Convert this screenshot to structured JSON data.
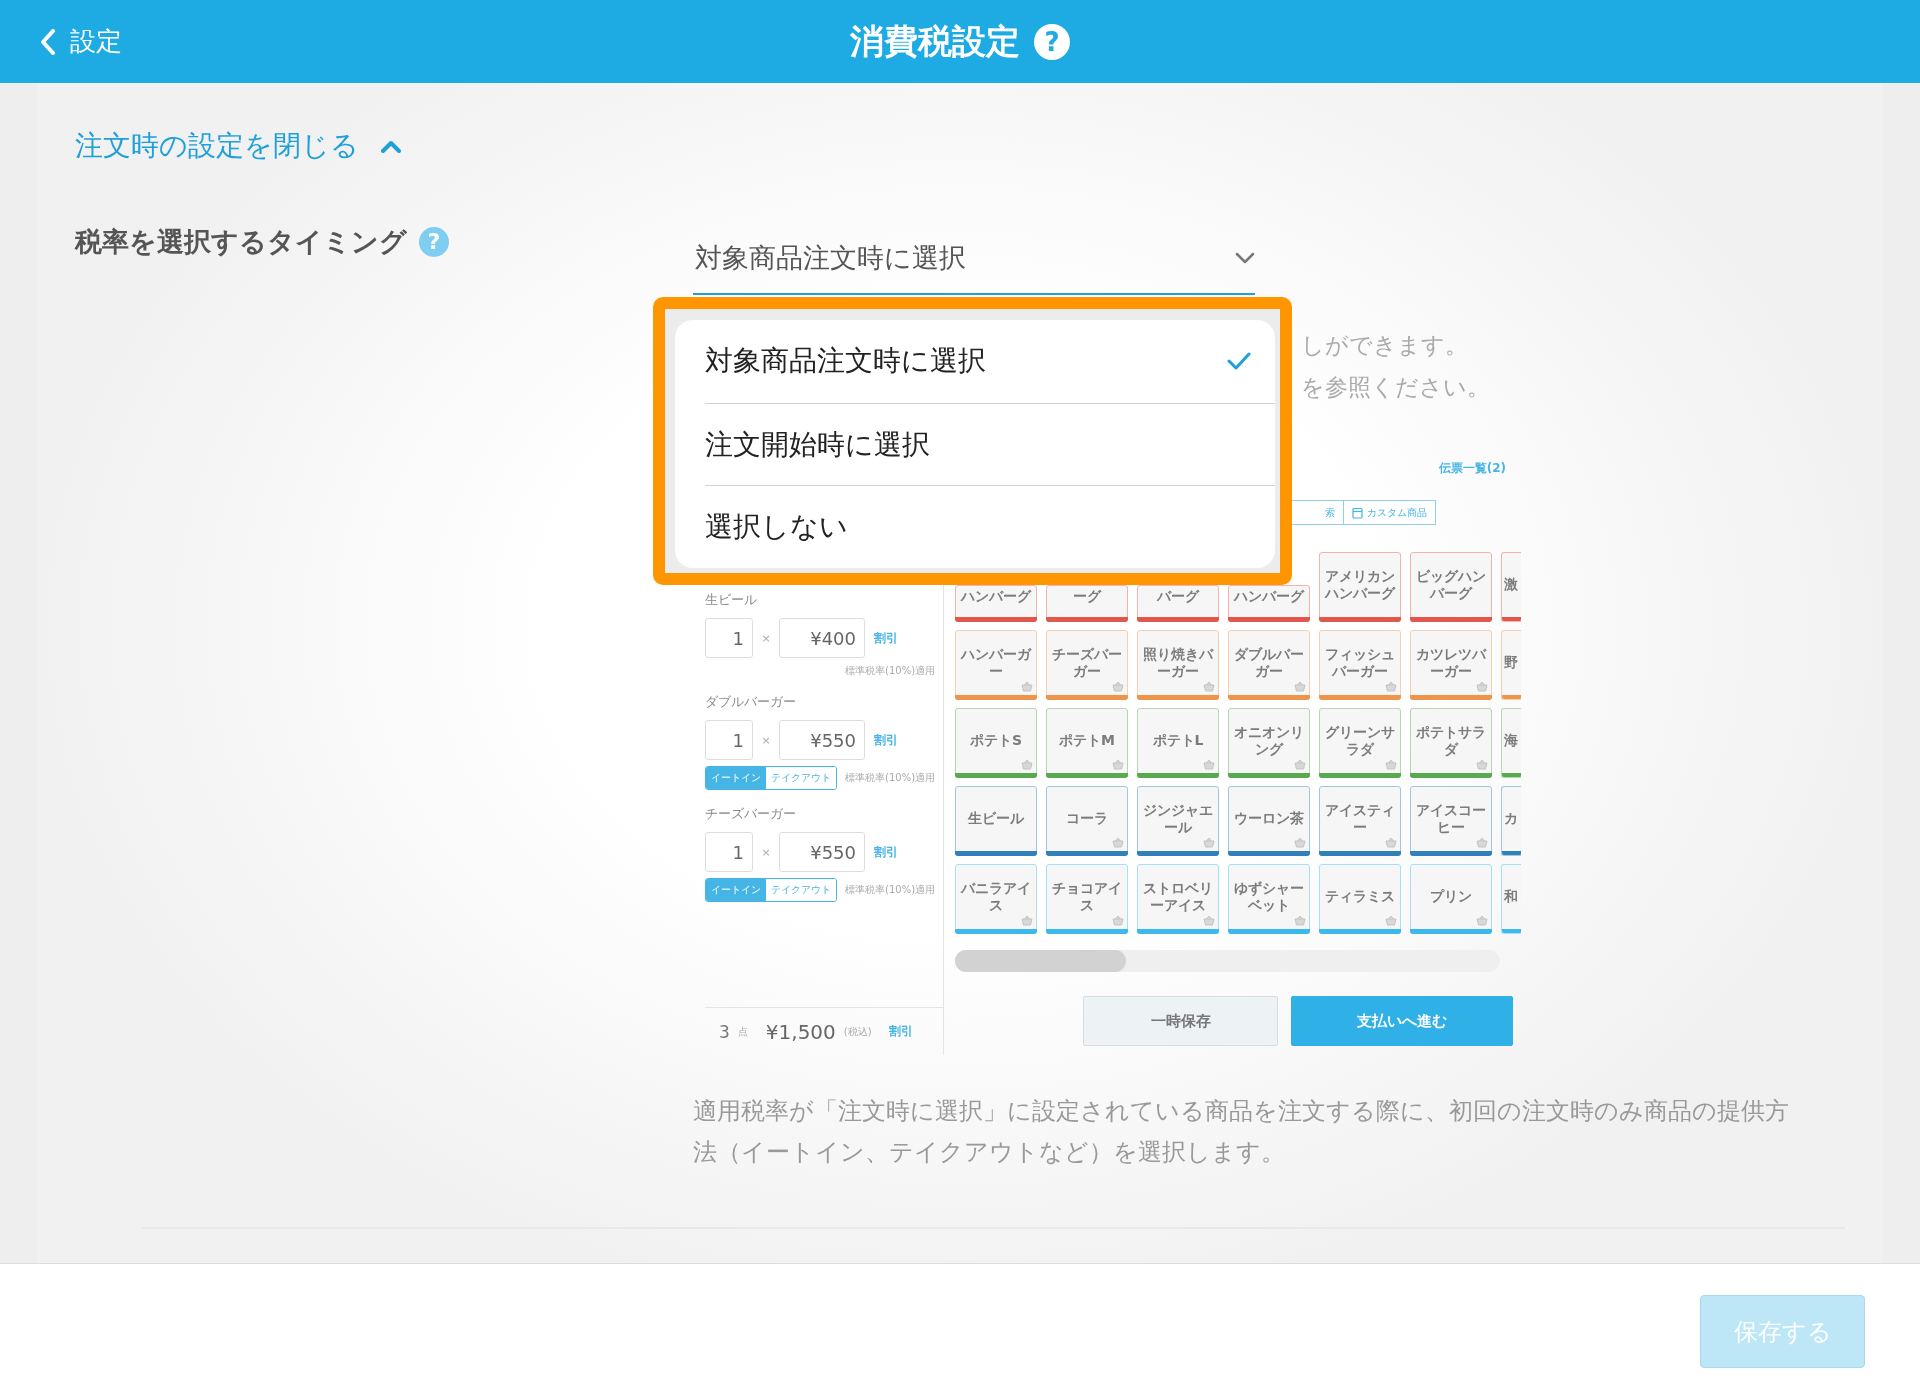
{
  "header": {
    "back_label": "設定",
    "title": "消費税設定",
    "help_icon": "?"
  },
  "collapse_link": "注文時の設定を閉じる",
  "setting": {
    "label": "税率を選択するタイミング",
    "help_icon": "?",
    "select_value": "対象商品注文時に選択"
  },
  "dropdown": {
    "options": [
      {
        "label": "対象商品注文時に選択",
        "selected": true
      },
      {
        "label": "注文開始時に選択",
        "selected": false
      },
      {
        "label": "選択しない",
        "selected": false
      }
    ]
  },
  "hint_lines": [
    "しができます。",
    "を参照ください。"
  ],
  "pos_mock": {
    "slip_list_link": "伝票一覧(2)",
    "tabs": [
      {
        "label": "索",
        "kind": "cut"
      },
      {
        "label": "カスタム商品",
        "kind": "full"
      }
    ],
    "order_items": [
      {
        "name": "生ビール",
        "quantity": "1",
        "multiply": "×",
        "price": "¥400",
        "discount": "割引",
        "note": "標準税率(10%)適用"
      },
      {
        "name": "ダブルバーガー",
        "quantity": "1",
        "multiply": "×",
        "price": "¥550",
        "discount": "割引",
        "note": "標準税率(10%)適用",
        "toggle": [
          {
            "label": "イートイン",
            "selected": true
          },
          {
            "label": "テイクアウト",
            "selected": false
          }
        ]
      },
      {
        "name": "チーズバーガー",
        "quantity": "1",
        "multiply": "×",
        "price": "¥550",
        "discount": "割引",
        "note": "標準税率(10%)適用",
        "toggle": [
          {
            "label": "イートイン",
            "selected": true
          },
          {
            "label": "テイクアウト",
            "selected": false
          }
        ]
      }
    ],
    "total": {
      "count": "3",
      "unit": "点",
      "amount": "¥1,500",
      "tax_note": "(税込)",
      "discount": "割引"
    },
    "product_rows": [
      {
        "color": "#e2574c",
        "cells": [
          {
            "label": "ハンバーグ",
            "kind": "cut",
            "basket": false
          },
          {
            "label": "ーグ",
            "kind": "cut",
            "basket": false
          },
          {
            "label": "バーグ",
            "kind": "cut",
            "basket": false
          },
          {
            "label": "ハンバーグ",
            "kind": "cut",
            "basket": false
          },
          {
            "label": "アメリカンハンバーグ",
            "kind": "full",
            "basket": false
          },
          {
            "label": "ビッグハンバーグ",
            "kind": "full",
            "basket": false
          },
          {
            "label": "激",
            "kind": "edge",
            "basket": false
          }
        ]
      },
      {
        "color": "#ef9549",
        "cells": [
          {
            "label": "ハンバーガー",
            "kind": "full",
            "basket": true
          },
          {
            "label": "チーズバーガー",
            "kind": "full",
            "basket": true
          },
          {
            "label": "照り焼きバーガー",
            "kind": "full",
            "basket": true
          },
          {
            "label": "ダブルバーガー",
            "kind": "full",
            "basket": true
          },
          {
            "label": "フィッシュバーガー",
            "kind": "full",
            "basket": true
          },
          {
            "label": "カツレツバーガー",
            "kind": "full",
            "basket": true
          },
          {
            "label": "野",
            "kind": "edge",
            "basket": false
          }
        ]
      },
      {
        "color": "#59a94f",
        "cells": [
          {
            "label": "ポテトS",
            "kind": "full",
            "basket": true
          },
          {
            "label": "ポテトM",
            "kind": "full",
            "basket": true
          },
          {
            "label": "ポテトL",
            "kind": "full",
            "basket": true
          },
          {
            "label": "オニオンリング",
            "kind": "full",
            "basket": true
          },
          {
            "label": "グリーンサラダ",
            "kind": "full",
            "basket": true
          },
          {
            "label": "ポテトサラダ",
            "kind": "full",
            "basket": true
          },
          {
            "label": "海",
            "kind": "edge",
            "basket": false
          }
        ]
      },
      {
        "color": "#2f81b7",
        "cells": [
          {
            "label": "生ビール",
            "kind": "full",
            "basket": false
          },
          {
            "label": "コーラ",
            "kind": "full",
            "basket": true
          },
          {
            "label": "ジンジャエール",
            "kind": "full",
            "basket": true
          },
          {
            "label": "ウーロン茶",
            "kind": "full",
            "basket": true
          },
          {
            "label": "アイスティー",
            "kind": "full",
            "basket": true
          },
          {
            "label": "アイスコーヒー",
            "kind": "full",
            "basket": true
          },
          {
            "label": "カ",
            "kind": "edge",
            "basket": false
          }
        ]
      },
      {
        "color": "#3cb9ec",
        "cells": [
          {
            "label": "バニラアイス",
            "kind": "full",
            "basket": true
          },
          {
            "label": "チョコアイス",
            "kind": "full",
            "basket": true
          },
          {
            "label": "ストロベリーアイス",
            "kind": "full",
            "basket": true
          },
          {
            "label": "ゆずシャーベット",
            "kind": "full",
            "basket": true
          },
          {
            "label": "ティラミス",
            "kind": "full",
            "basket": true
          },
          {
            "label": "プリン",
            "kind": "full",
            "basket": true
          },
          {
            "label": "和",
            "kind": "edge",
            "basket": false
          }
        ]
      }
    ],
    "buttons": [
      {
        "label": "一時保存",
        "primary": false
      },
      {
        "label": "支払いへ進む",
        "primary": true
      }
    ]
  },
  "description": "適用税率が「注文時に選択」に設定されている商品を注文する際に、初回の注文時のみ商品の提供方法（イートイン、テイクアウトなど）を選択します。",
  "footer": {
    "save_button": {
      "label": "保存する",
      "disabled": true
    }
  }
}
